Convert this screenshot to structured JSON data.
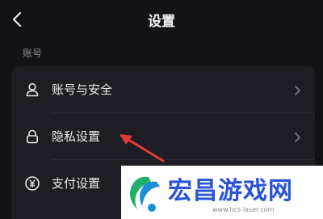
{
  "header": {
    "title": "设置",
    "back_icon": "back-chevron-icon"
  },
  "account_section": {
    "label": "账号",
    "items": [
      {
        "label": "账号与安全",
        "icon": "user-icon"
      },
      {
        "label": "隐私设置",
        "icon": "lock-icon"
      },
      {
        "label": "支付设置",
        "icon": "yuan-icon"
      }
    ]
  },
  "colors": {
    "background": "#121217",
    "card": "#1d1d23",
    "annotation_arrow": "#e53a3a",
    "watermark_blue": "#2a54d6"
  },
  "watermark": {
    "title": "宏昌游戏网",
    "url": "www.hcs-laser.com"
  }
}
